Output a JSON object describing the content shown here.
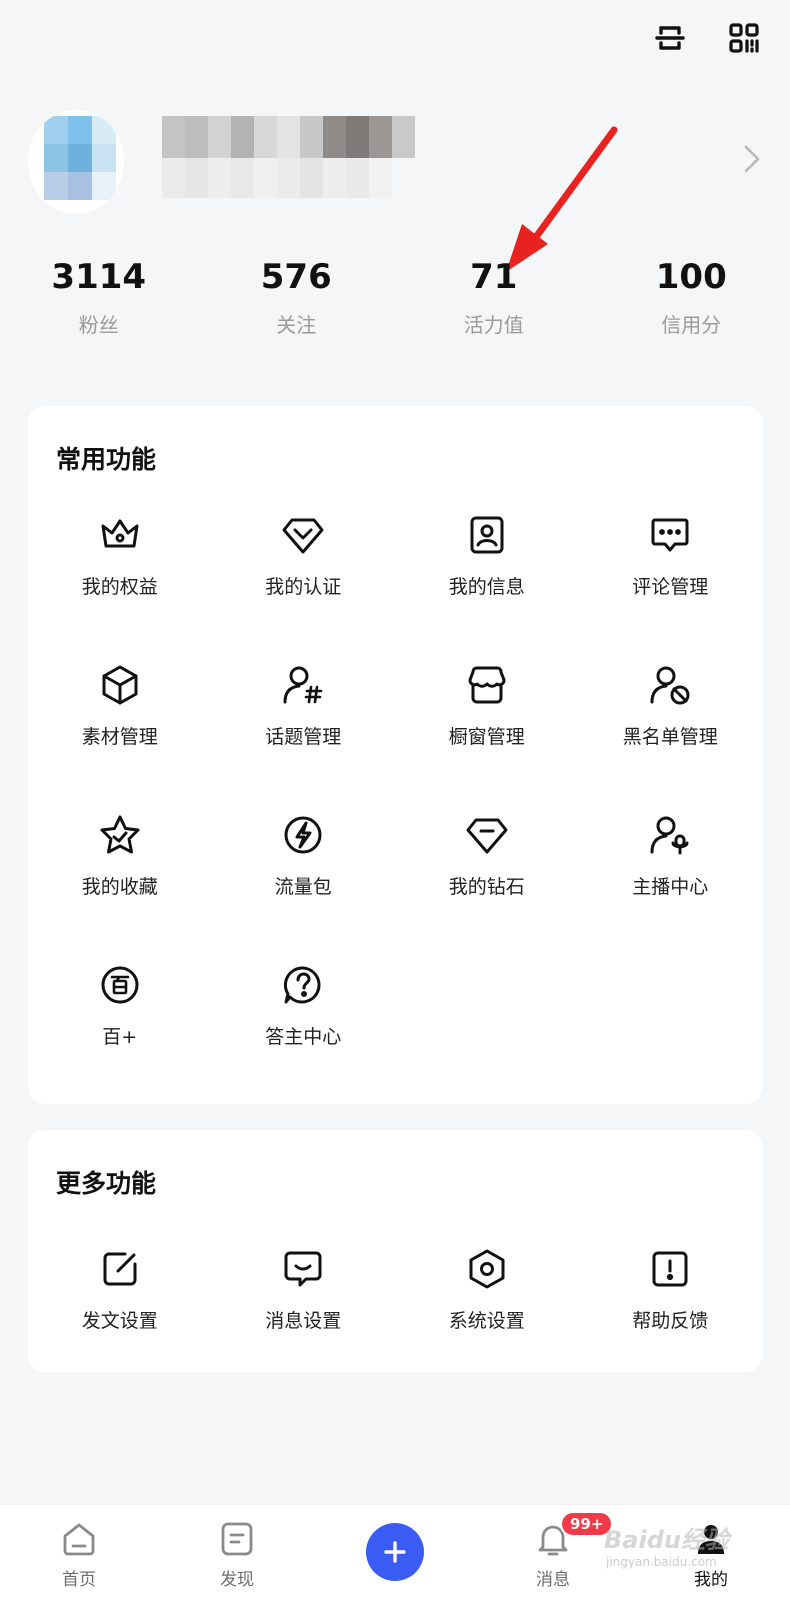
{
  "header": {
    "icons": [
      "scan-icon",
      "qrcode-icon"
    ]
  },
  "profile": {
    "arrow_icon": "chevron-right-icon"
  },
  "stats": [
    {
      "value": "3114",
      "label": "粉丝"
    },
    {
      "value": "576",
      "label": "关注"
    },
    {
      "value": "71",
      "label": "活力值"
    },
    {
      "value": "100",
      "label": "信用分"
    }
  ],
  "annotation": {
    "color": "#e8231f"
  },
  "common": {
    "title": "常用功能",
    "items": [
      {
        "label": "我的权益",
        "icon": "crown-icon"
      },
      {
        "label": "我的认证",
        "icon": "verified-badge-icon"
      },
      {
        "label": "我的信息",
        "icon": "profile-card-icon"
      },
      {
        "label": "评论管理",
        "icon": "comment-icon"
      },
      {
        "label": "素材管理",
        "icon": "cube-icon"
      },
      {
        "label": "话题管理",
        "icon": "user-hashtag-icon"
      },
      {
        "label": "橱窗管理",
        "icon": "storefront-icon"
      },
      {
        "label": "黑名单管理",
        "icon": "user-block-icon"
      },
      {
        "label": "我的收藏",
        "icon": "star-icon"
      },
      {
        "label": "流量包",
        "icon": "lightning-icon"
      },
      {
        "label": "我的钻石",
        "icon": "diamond-icon"
      },
      {
        "label": "主播中心",
        "icon": "user-mic-icon"
      },
      {
        "label": "百+",
        "icon": "bai-icon"
      },
      {
        "label": "答主中心",
        "icon": "question-bubble-icon"
      }
    ]
  },
  "more": {
    "title": "更多功能",
    "items": [
      {
        "label": "发文设置",
        "icon": "edit-square-icon"
      },
      {
        "label": "消息设置",
        "icon": "message-box-icon"
      },
      {
        "label": "系统设置",
        "icon": "hexagon-settings-icon"
      },
      {
        "label": "帮助反馈",
        "icon": "exclamation-square-icon"
      }
    ]
  },
  "tabbar": {
    "tabs": [
      {
        "label": "首页",
        "icon": "home-icon"
      },
      {
        "label": "发现",
        "icon": "discover-icon"
      },
      {
        "label": "",
        "icon": "plus-icon"
      },
      {
        "label": "消息",
        "icon": "bell-icon",
        "badge": "99+"
      },
      {
        "label": "我的",
        "icon": "person-icon"
      }
    ]
  },
  "watermark": {
    "text": "Baidu经验",
    "sub": "jingyan.baidu.com"
  },
  "colors": {
    "accent": "#3b5bf5",
    "badge": "#f23a48",
    "background": "#f5f6f8"
  }
}
